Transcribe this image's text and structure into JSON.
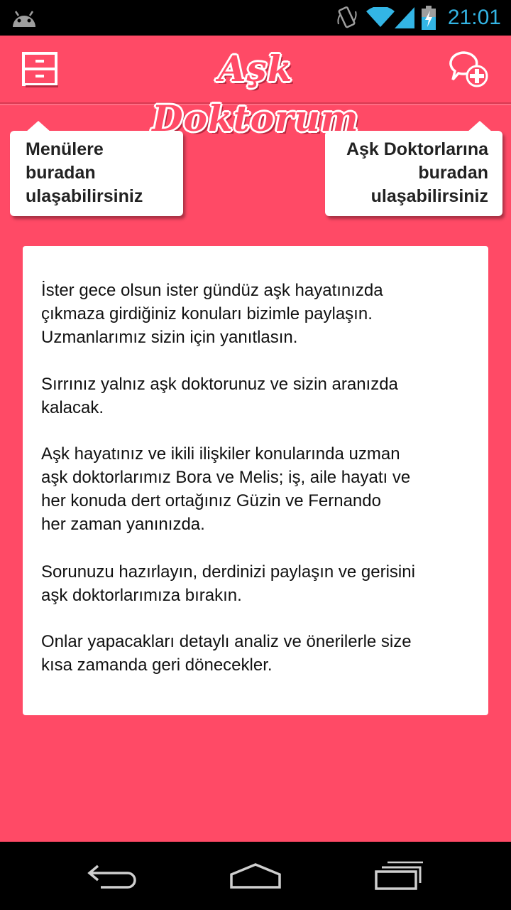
{
  "status_bar": {
    "time": "21:01",
    "icons": [
      "android-icon",
      "rotate-icon",
      "wifi-icon",
      "signal-icon",
      "battery-charging-icon"
    ]
  },
  "header": {
    "logo_text": "Aşk Doktorum",
    "menu_icon": "drawer-menu-icon",
    "chat_icon": "new-chat-icon"
  },
  "tooltips": {
    "left": {
      "lines": [
        "Menülere",
        "buradan",
        "ulaşabilirsiniz"
      ]
    },
    "right": {
      "lines": [
        "Aşk Doktorlarına",
        "buradan",
        "ulaşabilirsiniz"
      ]
    }
  },
  "card": {
    "paragraphs": [
      [
        "İster gece olsun ister gündüz aşk hayatınızda",
        "çıkmaza girdiğiniz konuları bizimle paylaşın.",
        "Uzmanlarımız sizin için yanıtlasın."
      ],
      [
        "Sırrınız yalnız aşk doktorunuz ve sizin aranızda",
        "kalacak."
      ],
      [
        "Aşk hayatınız ve ikili ilişkiler konularında uzman",
        "aşk doktorlarımız Bora ve Melis; iş, aile hayatı ve",
        "her konuda dert ortağınız Güzin ve Fernando",
        "her zaman yanınızda."
      ],
      [
        "Sorunuzu hazırlayın, derdinizi paylaşın ve gerisini",
        "aşk doktorlarımıza bırakın."
      ],
      [
        "Onlar yapacakları detaylı analiz ve önerilerle size",
        "kısa zamanda geri dönecekler."
      ]
    ]
  },
  "nav_bar": {
    "icons": [
      "back-icon",
      "home-icon",
      "recents-icon"
    ]
  },
  "colors": {
    "background": "#ff4a66",
    "status_accent": "#33b5e5",
    "card": "#ffffff"
  }
}
